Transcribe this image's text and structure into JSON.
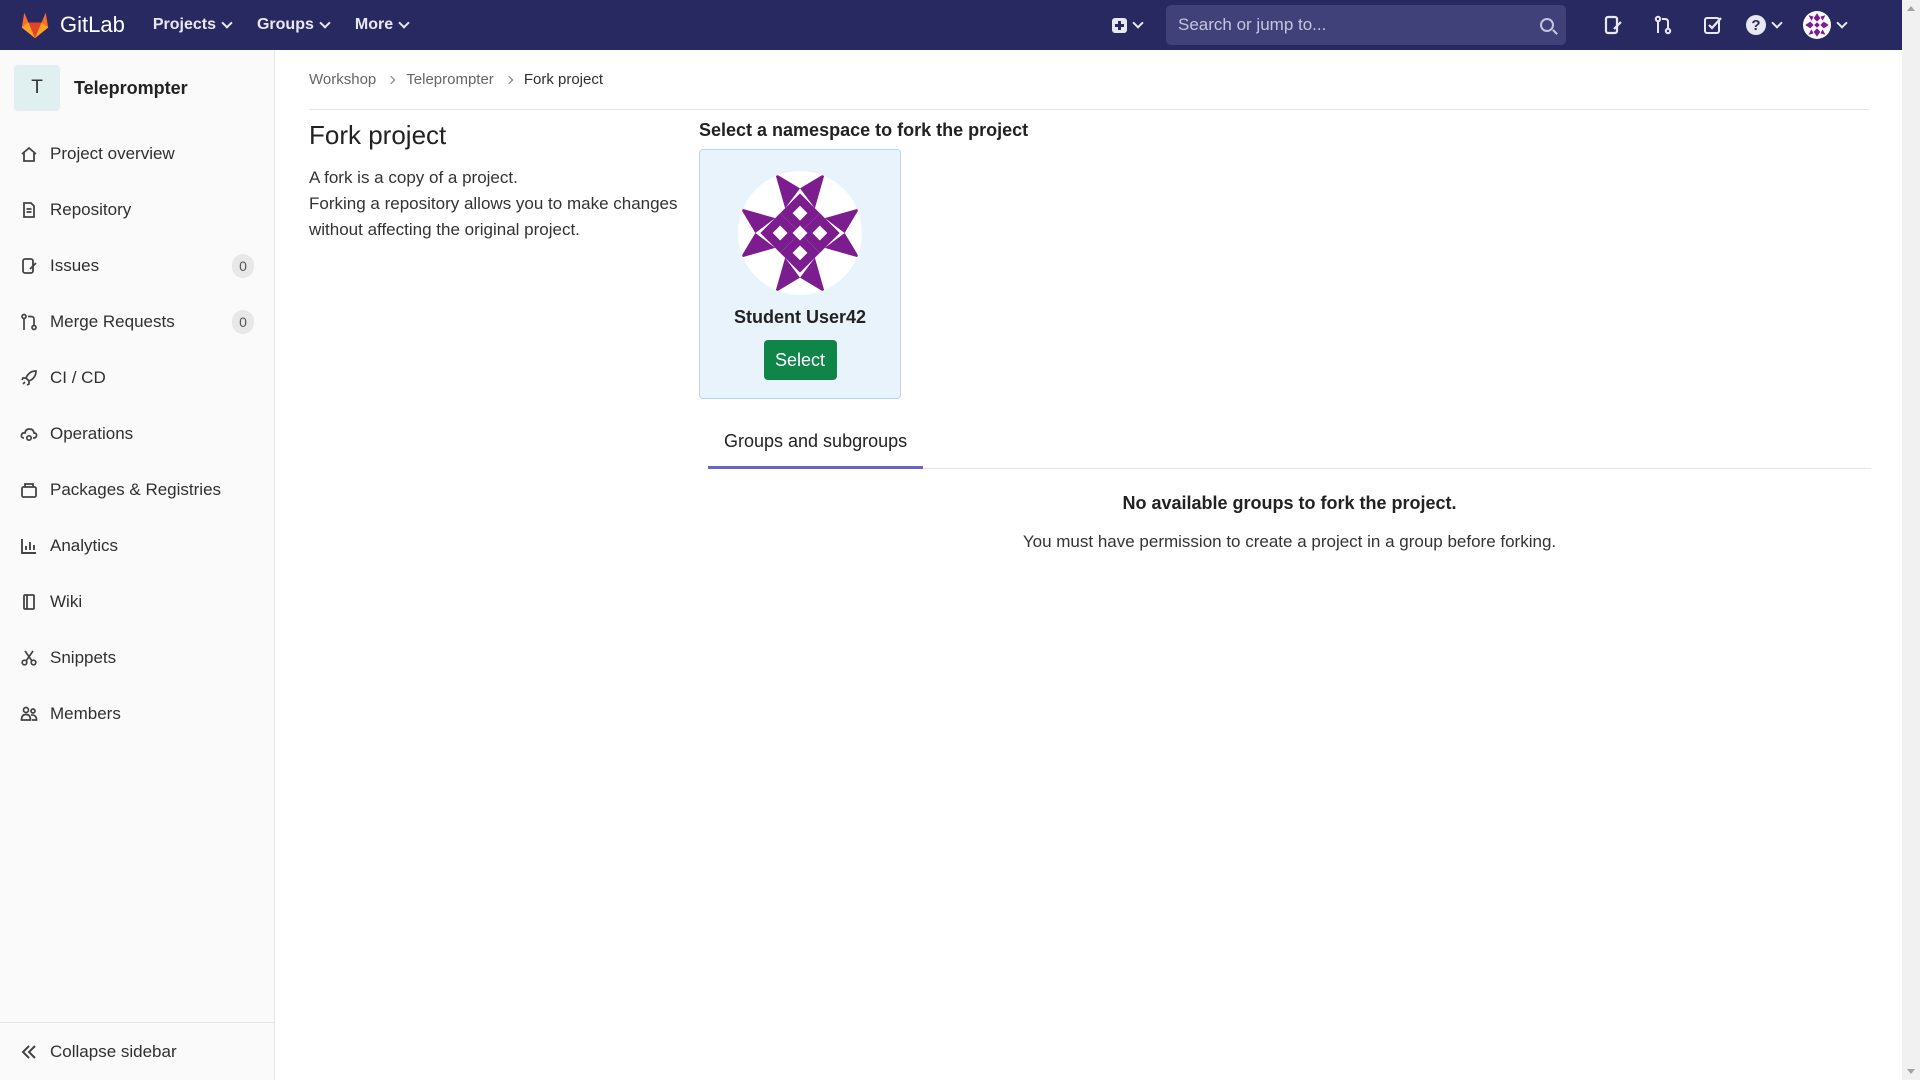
{
  "navbar": {
    "logo_text": "GitLab",
    "menu": [
      "Projects",
      "Groups",
      "More"
    ],
    "search_placeholder": "Search or jump to..."
  },
  "sidebar": {
    "project_initial": "T",
    "project_name": "Teleprompter",
    "items": [
      {
        "label": "Project overview",
        "icon": "home-icon"
      },
      {
        "label": "Repository",
        "icon": "document-icon"
      },
      {
        "label": "Issues",
        "icon": "issues-icon",
        "badge": "0"
      },
      {
        "label": "Merge Requests",
        "icon": "merge-request-icon",
        "badge": "0"
      },
      {
        "label": "CI / CD",
        "icon": "rocket-icon"
      },
      {
        "label": "Operations",
        "icon": "cloud-gear-icon"
      },
      {
        "label": "Packages & Registries",
        "icon": "package-icon"
      },
      {
        "label": "Analytics",
        "icon": "chart-icon"
      },
      {
        "label": "Wiki",
        "icon": "book-icon"
      },
      {
        "label": "Snippets",
        "icon": "scissors-icon"
      },
      {
        "label": "Members",
        "icon": "users-icon"
      }
    ],
    "collapse_label": "Collapse sidebar"
  },
  "breadcrumb": {
    "items": [
      "Workshop",
      "Teleprompter"
    ],
    "current": "Fork project"
  },
  "main": {
    "title": "Fork project",
    "description_line1": "A fork is a copy of a project.",
    "description_line2": "Forking a repository allows you to make changes without affecting the original project.",
    "namespace_title": "Select a namespace to fork the project",
    "namespace_user": "Student User42",
    "select_label": "Select",
    "tab_label": "Groups and subgroups",
    "empty_title": "No available groups to fork the project.",
    "empty_desc": "You must have permission to create a project in a group before forking."
  },
  "colors": {
    "navbar": "#292961",
    "select_button": "#108548",
    "avatar_purple": "#7b1d8e",
    "tab_underline": "#6666c4"
  }
}
